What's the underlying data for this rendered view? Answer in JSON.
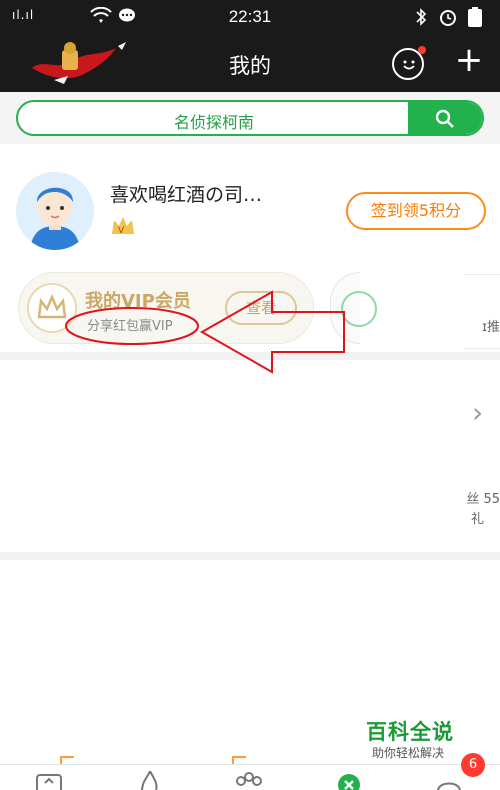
{
  "status_bar": {
    "signal": "ıl.ıl",
    "time": "22:31"
  },
  "header": {
    "title": "我的"
  },
  "search": {
    "text": "名侦探柯南"
  },
  "profile": {
    "nickname": "喜欢喝红酒の司…",
    "checkin_label": "签到领5积分"
  },
  "vip": {
    "title": "我的VIP会员",
    "subtitle": "分享红包赢VIP",
    "view_label": "查看"
  },
  "side_fragments": {
    "frag1": "ɪ推",
    "frag2": "丝 55",
    "frag3": "礼"
  },
  "watermark": {
    "title": "百科全说",
    "subtitle": "助你轻松解决"
  },
  "tab_bar": {
    "badge_count": "6"
  },
  "colors": {
    "accent_green": "#22b14c",
    "checkin_orange": "#ff8c1a",
    "vip_gold": "#b8862b",
    "annotation_red": "#e0141e"
  }
}
